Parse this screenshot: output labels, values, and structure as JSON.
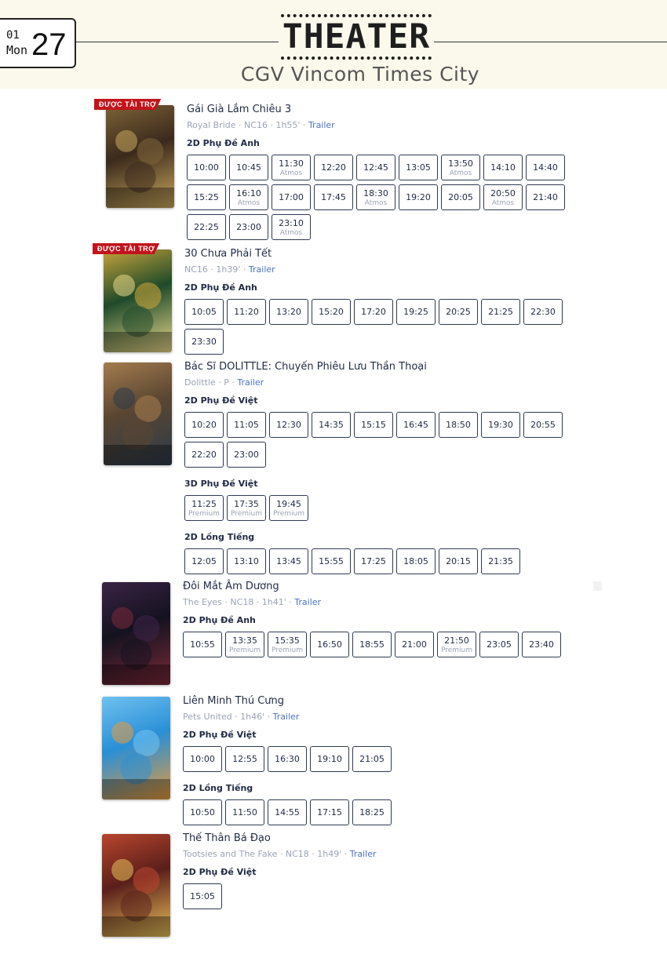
{
  "header": {
    "date_month": "01",
    "date_dow": "Mon",
    "date_day": "27",
    "title": "THEATER",
    "cinema": "CGV Vincom Times City"
  },
  "movies": [
    {
      "badge": "ĐƯỢC TÀI TRỢ",
      "title": "Gái Già Lắm Chiêu 3",
      "meta": "Royal Bride · NC16 · 1h55' · ",
      "trailer": "Trailer",
      "poster_colors": [
        "#3b2a1c",
        "#7c6238",
        "#c9a85f"
      ],
      "formats": [
        {
          "label": "2D Phụ Đề Anh",
          "times": [
            {
              "time": "10:00",
              "sub": ""
            },
            {
              "time": "10:45",
              "sub": ""
            },
            {
              "time": "11:30",
              "sub": "Atmos"
            },
            {
              "time": "12:20",
              "sub": ""
            },
            {
              "time": "12:45",
              "sub": ""
            },
            {
              "time": "13:05",
              "sub": ""
            },
            {
              "time": "13:50",
              "sub": "Atmos"
            },
            {
              "time": "14:10",
              "sub": ""
            },
            {
              "time": "14:40",
              "sub": ""
            },
            {
              "time": "15:25",
              "sub": ""
            },
            {
              "time": "16:10",
              "sub": "Atmos"
            },
            {
              "time": "17:00",
              "sub": ""
            },
            {
              "time": "17:45",
              "sub": ""
            },
            {
              "time": "18:30",
              "sub": "Atmos"
            },
            {
              "time": "19:20",
              "sub": ""
            },
            {
              "time": "20:05",
              "sub": ""
            },
            {
              "time": "20:50",
              "sub": "Atmos"
            },
            {
              "time": "21:40",
              "sub": ""
            },
            {
              "time": "22:25",
              "sub": ""
            },
            {
              "time": "23:00",
              "sub": ""
            },
            {
              "time": "23:10",
              "sub": "Atmos"
            }
          ]
        }
      ]
    },
    {
      "badge": "ĐƯỢC TÀI TRỢ",
      "title": "30 Chưa Phải Tết",
      "meta": "NC16 · 1h39' · ",
      "trailer": "Trailer",
      "poster_colors": [
        "#1f4a2a",
        "#c7a43a",
        "#e9d98a"
      ],
      "formats": [
        {
          "label": "2D Phụ Đề Anh",
          "times": [
            {
              "time": "10:05",
              "sub": ""
            },
            {
              "time": "11:20",
              "sub": ""
            },
            {
              "time": "13:20",
              "sub": ""
            },
            {
              "time": "15:20",
              "sub": ""
            },
            {
              "time": "17:20",
              "sub": ""
            },
            {
              "time": "19:25",
              "sub": ""
            },
            {
              "time": "20:25",
              "sub": ""
            },
            {
              "time": "21:25",
              "sub": ""
            },
            {
              "time": "22:30",
              "sub": ""
            },
            {
              "time": "23:30",
              "sub": ""
            }
          ]
        }
      ]
    },
    {
      "badge": "",
      "title": "Bác Sĩ DOLITTLE: Chuyến Phiêu Lưu Thần Thoại",
      "meta": "Dolittle · P · ",
      "trailer": "Trailer",
      "poster_colors": [
        "#5a4632",
        "#a37c4e",
        "#2c3b4a"
      ],
      "formats": [
        {
          "label": "2D Phụ Đề Việt",
          "times": [
            {
              "time": "10:20",
              "sub": ""
            },
            {
              "time": "11:05",
              "sub": ""
            },
            {
              "time": "12:30",
              "sub": ""
            },
            {
              "time": "14:35",
              "sub": ""
            },
            {
              "time": "15:15",
              "sub": ""
            },
            {
              "time": "16:45",
              "sub": ""
            },
            {
              "time": "18:50",
              "sub": ""
            },
            {
              "time": "19:30",
              "sub": ""
            },
            {
              "time": "20:55",
              "sub": ""
            },
            {
              "time": "22:20",
              "sub": ""
            },
            {
              "time": "23:00",
              "sub": ""
            }
          ]
        },
        {
          "label": "3D Phụ Đề Việt",
          "times": [
            {
              "time": "11:25",
              "sub": "Premium"
            },
            {
              "time": "17:35",
              "sub": "Premium"
            },
            {
              "time": "19:45",
              "sub": "Premium"
            }
          ]
        },
        {
          "label": "2D Lồng Tiếng",
          "times": [
            {
              "time": "12:05",
              "sub": ""
            },
            {
              "time": "13:10",
              "sub": ""
            },
            {
              "time": "13:45",
              "sub": ""
            },
            {
              "time": "15:55",
              "sub": ""
            },
            {
              "time": "17:25",
              "sub": ""
            },
            {
              "time": "18:05",
              "sub": ""
            },
            {
              "time": "20:15",
              "sub": ""
            },
            {
              "time": "21:35",
              "sub": ""
            }
          ]
        }
      ]
    },
    {
      "badge": "",
      "title": "Đôi Mắt Âm Dương",
      "meta": "The Eyes · NC18 · 1h41' · ",
      "trailer": "Trailer",
      "poster_colors": [
        "#14121f",
        "#3a2346",
        "#7a2a3a"
      ],
      "formats": [
        {
          "label": "2D Phụ Đề Anh",
          "times": [
            {
              "time": "10:55",
              "sub": ""
            },
            {
              "time": "13:35",
              "sub": "Premium"
            },
            {
              "time": "15:35",
              "sub": "Premium"
            },
            {
              "time": "16:50",
              "sub": ""
            },
            {
              "time": "18:55",
              "sub": ""
            },
            {
              "time": "21:00",
              "sub": ""
            },
            {
              "time": "21:50",
              "sub": "Premium"
            },
            {
              "time": "23:05",
              "sub": ""
            },
            {
              "time": "23:40",
              "sub": ""
            }
          ]
        }
      ]
    },
    {
      "badge": "",
      "title": "Liên Minh Thú Cưng",
      "meta": "Pets United · 1h46' · ",
      "trailer": "Trailer",
      "poster_colors": [
        "#2a8fd6",
        "#6fc1f0",
        "#e89b3a"
      ],
      "formats": [
        {
          "label": "2D Phụ Đề Việt",
          "times": [
            {
              "time": "10:00",
              "sub": ""
            },
            {
              "time": "12:55",
              "sub": ""
            },
            {
              "time": "16:30",
              "sub": ""
            },
            {
              "time": "19:10",
              "sub": ""
            },
            {
              "time": "21:05",
              "sub": ""
            }
          ]
        },
        {
          "label": "2D Lồng Tiếng",
          "times": [
            {
              "time": "10:50",
              "sub": ""
            },
            {
              "time": "11:50",
              "sub": ""
            },
            {
              "time": "14:55",
              "sub": ""
            },
            {
              "time": "17:15",
              "sub": ""
            },
            {
              "time": "18:25",
              "sub": ""
            }
          ]
        }
      ]
    },
    {
      "badge": "",
      "title": "Thế Thân Bá Đạo",
      "meta": "Tootsies and The Fake · NC18 · 1h49' · ",
      "trailer": "Trailer",
      "poster_colors": [
        "#5a1f1a",
        "#b8452e",
        "#e7c05a"
      ],
      "formats": [
        {
          "label": "2D Phụ Đề Việt",
          "times": [
            {
              "time": "15:05",
              "sub": ""
            }
          ]
        }
      ]
    }
  ]
}
